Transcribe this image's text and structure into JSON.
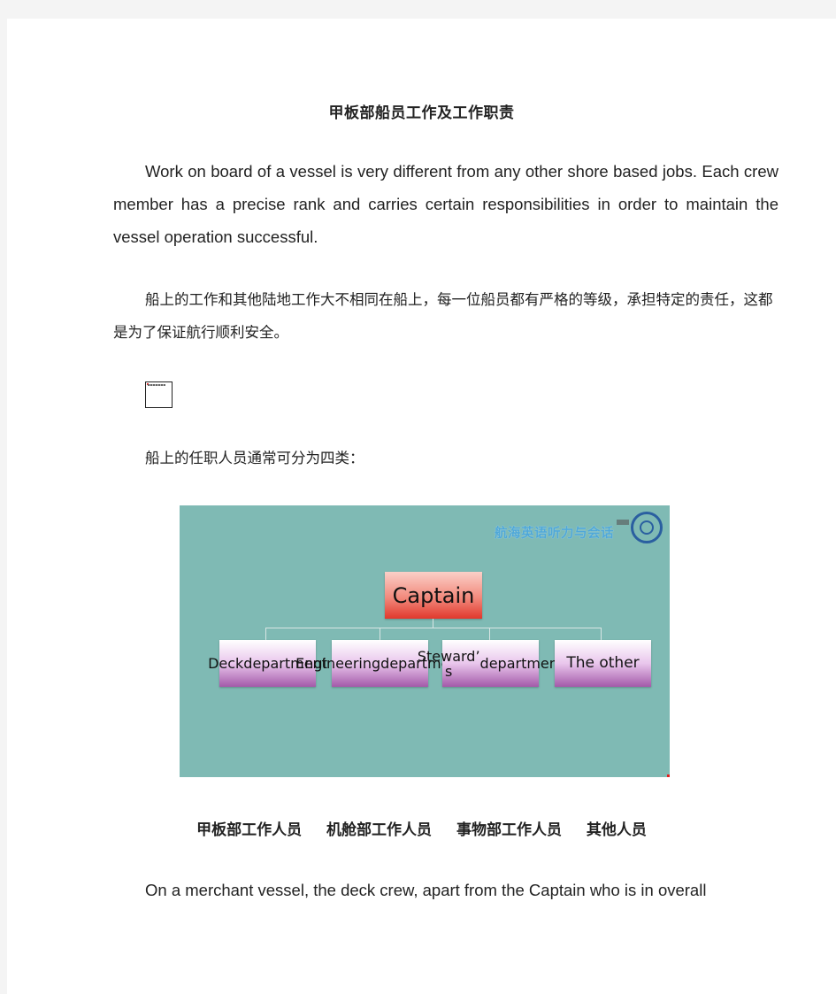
{
  "document": {
    "title": "甲板部船员工作及工作职责",
    "paragraph_en_1": "Work on board of a vessel is very different from any other shore based jobs. Each crew member has a precise rank and carries certain responsibilities in order to maintain the vessel operation successful.",
    "paragraph_zh_1": "船上的工作和其他陆地工作大不相同在船上，每一位船员都有严格的等级，承担特定的责任，这都是为了保证航行顺利安全。",
    "broken_image_icon": "broken-image-icon",
    "paragraph_zh_2": "船上的任职人员通常可分为四类：",
    "slide": {
      "brand_text": "航海英语听力与会话",
      "logo_icon": "university-seal-icon",
      "background_color": "#7fbab4",
      "org_chart": {
        "root": "Captain",
        "root_color": "#e0382c",
        "children": [
          "Deck department",
          "Engineering department",
          "Steward’ s department",
          "The other"
        ],
        "child_color": "#a35aa9"
      }
    },
    "caption": [
      "甲板部工作人员",
      "机舱部工作人员",
      "事物部工作人员",
      "其他人员"
    ],
    "paragraph_en_2": "On a merchant vessel, the deck crew, apart from the Captain who is in overall"
  }
}
